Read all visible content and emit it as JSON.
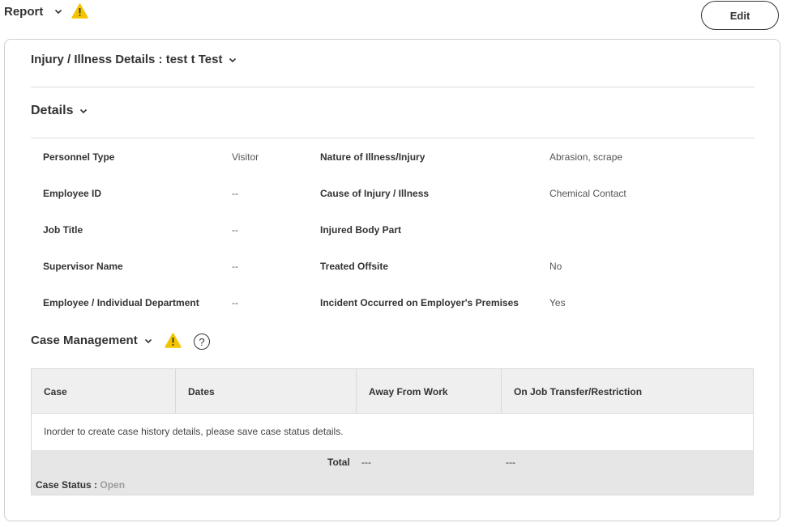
{
  "header": {
    "title": "Report",
    "edit_label": "Edit"
  },
  "injury_section": {
    "title": "Injury / Illness Details : test t Test"
  },
  "details_section": {
    "title": "Details",
    "left_fields": [
      {
        "label": "Personnel Type",
        "value": "Visitor"
      },
      {
        "label": "Employee ID",
        "value": "--"
      },
      {
        "label": "Job Title",
        "value": "--"
      },
      {
        "label": "Supervisor Name",
        "value": "--"
      },
      {
        "label": "Employee / Individual Department",
        "value": "--"
      }
    ],
    "right_fields": [
      {
        "label": "Nature of Illness/Injury",
        "value": "Abrasion, scrape"
      },
      {
        "label": "Cause of Injury / Illness",
        "value": "Chemical Contact"
      },
      {
        "label": "Injured Body Part",
        "value": ""
      },
      {
        "label": "Treated Offsite",
        "value": "No"
      },
      {
        "label": "Incident Occurred on Employer's Premises",
        "value": "Yes"
      }
    ]
  },
  "case_management": {
    "title": "Case Management",
    "help_glyph": "?",
    "columns": [
      "Case",
      "Dates",
      "Away From Work",
      "On Job Transfer/Restriction"
    ],
    "empty_message": "Inorder to create case history details, please save case status details.",
    "total_label": "Total",
    "total_away": "---",
    "total_transfer": "---",
    "status_label": "Case Status :",
    "status_value": "Open"
  },
  "colors": {
    "warning": "#f5c400",
    "header_bg": "#efefef",
    "footer_bg": "#e6e6e6",
    "muted_status": "#9c9c9c"
  },
  "icons": [
    "chevron-down-icon",
    "warning-icon",
    "help-icon"
  ]
}
